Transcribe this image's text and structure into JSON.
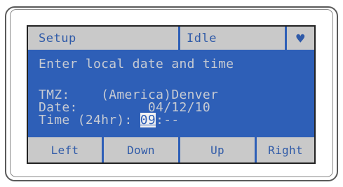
{
  "status": {
    "mode": "Setup",
    "state": "Idle",
    "icon": "heart-icon",
    "icon_glyph": "♥"
  },
  "prompt": "Enter local date and time",
  "fields": {
    "tmz_label": "TMZ:",
    "tmz_value": "(America)Denver",
    "date_label": "Date:",
    "date_value": "04/12/10",
    "time_label": "Time (24hr):",
    "time_hour": "09",
    "time_rest": ":--"
  },
  "softkeys": {
    "left": "Left",
    "down": "Down",
    "up": "Up",
    "right": "Right"
  },
  "colors": {
    "screen_bg": "#2e5fb7",
    "bar_bg": "#c9c9c9",
    "bar_text": "#2f5aa8",
    "lcd_text": "#c7cbd3"
  }
}
